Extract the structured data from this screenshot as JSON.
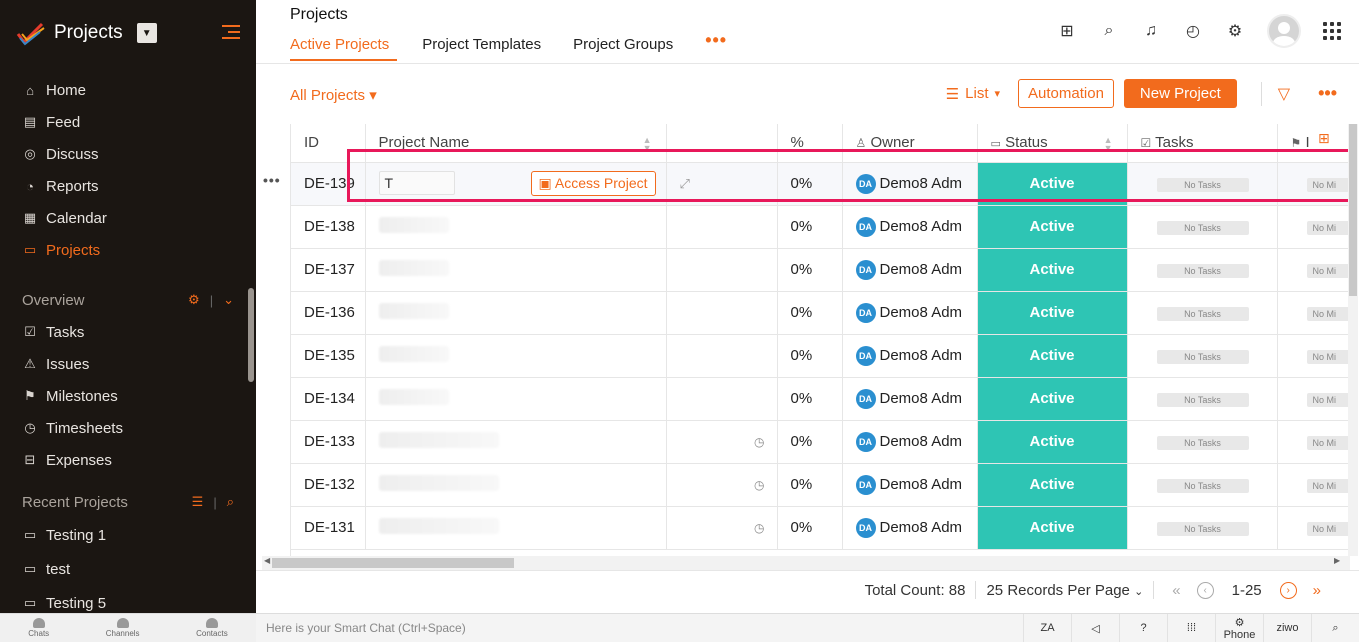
{
  "sidebar": {
    "brand_title": "Projects",
    "nav": [
      {
        "label": "Home",
        "icon": "home-icon"
      },
      {
        "label": "Feed",
        "icon": "feed-icon"
      },
      {
        "label": "Discuss",
        "icon": "discuss-icon"
      },
      {
        "label": "Reports",
        "icon": "reports-icon"
      },
      {
        "label": "Calendar",
        "icon": "calendar-icon"
      },
      {
        "label": "Projects",
        "icon": "projects-icon",
        "active": true
      }
    ],
    "overview_title": "Overview",
    "overview_items": [
      "Tasks",
      "Issues",
      "Milestones",
      "Timesheets",
      "Expenses"
    ],
    "recent_title": "Recent Projects",
    "recent_items": [
      "Testing 1",
      "test",
      "Testing 5"
    ]
  },
  "header": {
    "page_title": "Projects",
    "tabs": [
      "Active Projects",
      "Project Templates",
      "Project Groups"
    ]
  },
  "toolbar": {
    "filter_label": "All Projects",
    "list_label": "List",
    "automation_label": "Automation",
    "new_project_label": "New Project"
  },
  "table": {
    "headers": {
      "id": "ID",
      "name": "Project Name",
      "percent": "%",
      "owner": "Owner",
      "status": "Status",
      "tasks": "Tasks",
      "milestones": "I"
    },
    "first_row_name": "T",
    "access_label": "Access Project",
    "rows": [
      {
        "id": "DE-139",
        "percent": "0%",
        "owner": "Demo8 Adm",
        "owner_initials": "DA",
        "status": "Active",
        "tasks": "No Tasks",
        "milestones": "No Mi"
      },
      {
        "id": "DE-138",
        "percent": "0%",
        "owner": "Demo8 Adm",
        "owner_initials": "DA",
        "status": "Active",
        "tasks": "No Tasks",
        "milestones": "No Mi"
      },
      {
        "id": "DE-137",
        "percent": "0%",
        "owner": "Demo8 Adm",
        "owner_initials": "DA",
        "status": "Active",
        "tasks": "No Tasks",
        "milestones": "No Mi"
      },
      {
        "id": "DE-136",
        "percent": "0%",
        "owner": "Demo8 Adm",
        "owner_initials": "DA",
        "status": "Active",
        "tasks": "No Tasks",
        "milestones": "No Mi"
      },
      {
        "id": "DE-135",
        "percent": "0%",
        "owner": "Demo8 Adm",
        "owner_initials": "DA",
        "status": "Active",
        "tasks": "No Tasks",
        "milestones": "No Mi"
      },
      {
        "id": "DE-134",
        "percent": "0%",
        "owner": "Demo8 Adm",
        "owner_initials": "DA",
        "status": "Active",
        "tasks": "No Tasks",
        "milestones": "No Mi"
      },
      {
        "id": "DE-133",
        "percent": "0%",
        "owner": "Demo8 Adm",
        "owner_initials": "DA",
        "status": "Active",
        "tasks": "No Tasks",
        "milestones": "No Mi"
      },
      {
        "id": "DE-132",
        "percent": "0%",
        "owner": "Demo8 Adm",
        "owner_initials": "DA",
        "status": "Active",
        "tasks": "No Tasks",
        "milestones": "No Mi"
      },
      {
        "id": "DE-131",
        "percent": "0%",
        "owner": "Demo8 Adm",
        "owner_initials": "DA",
        "status": "Active",
        "tasks": "No Tasks",
        "milestones": "No Mi"
      }
    ]
  },
  "footer": {
    "total_count": "Total Count: 88",
    "per_page": "25 Records Per Page",
    "range": "1-25"
  },
  "bottombar": {
    "chats": "Chats",
    "channels": "Channels",
    "contacts": "Contacts",
    "smart_chat_placeholder": "Here is your Smart Chat (Ctrl+Space)",
    "phone": "Phone",
    "ziwo": "ziwo"
  },
  "colors": {
    "accent": "#f26b1d",
    "status_active": "#2ec5b4",
    "sidebar_bg": "#1b1612",
    "highlight": "#e8185a"
  }
}
